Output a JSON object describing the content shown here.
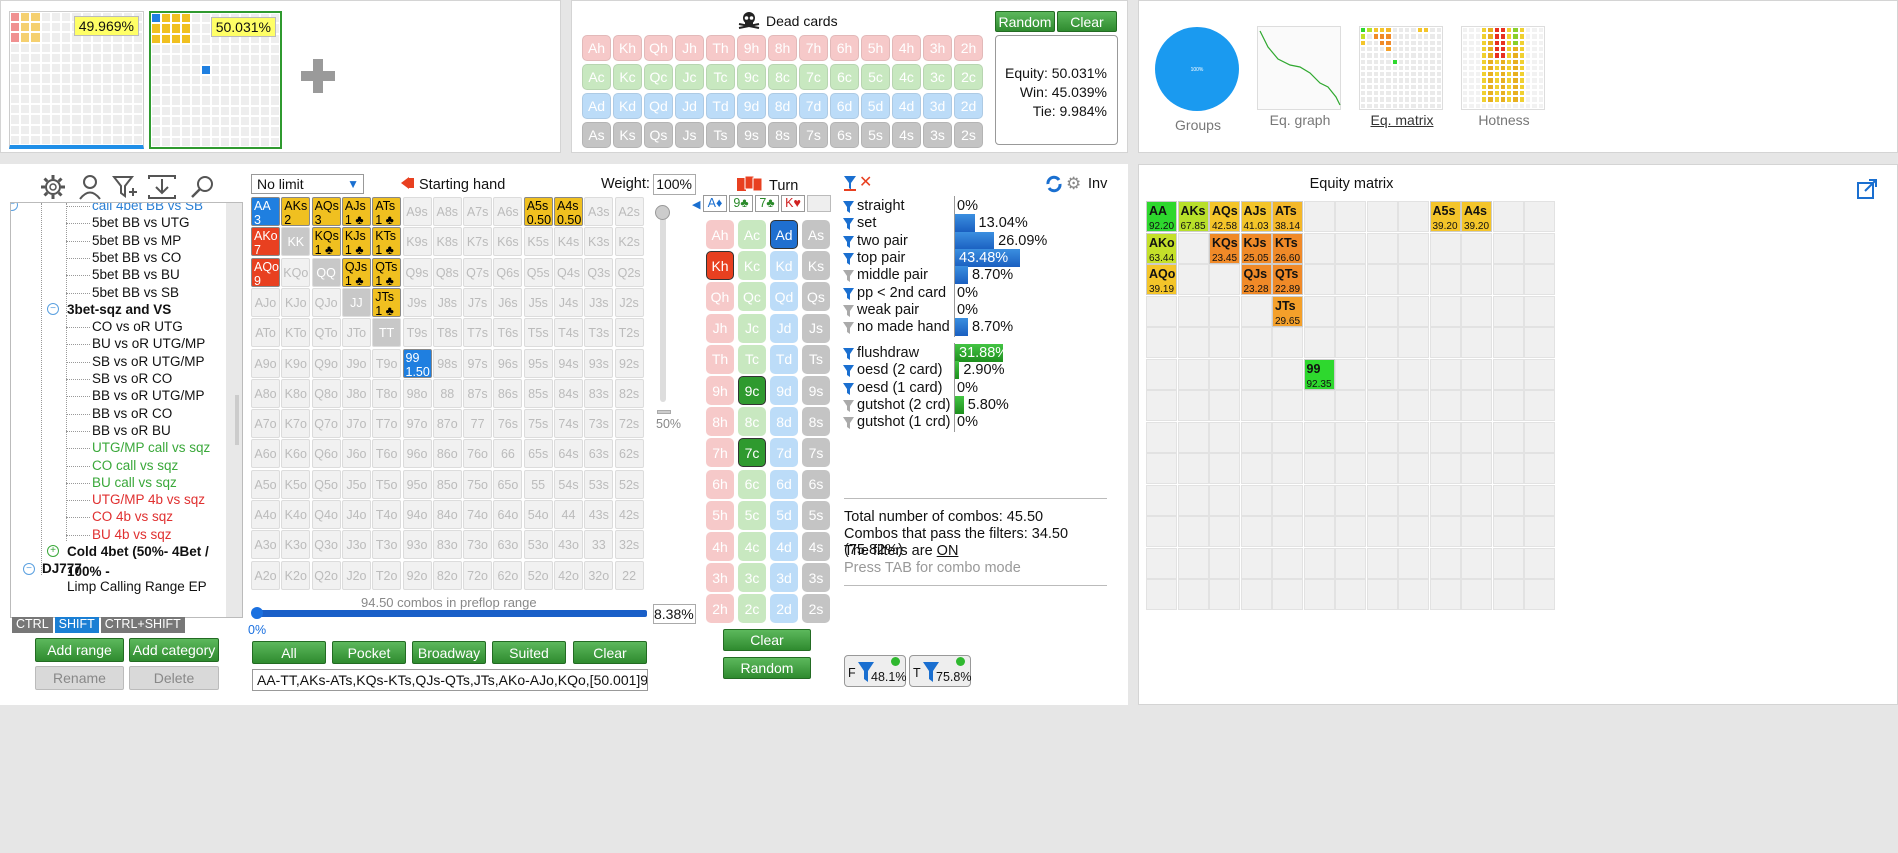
{
  "top_left": {
    "equity_left": "49.969%",
    "equity_right": "50.031%",
    "add_icon": "plus-icon"
  },
  "dead_cards": {
    "title": "Dead cards",
    "icon": "skull-icon",
    "random_label": "Random",
    "clear_label": "Clear",
    "rows": [
      {
        "color": "#f6c9c9",
        "text_color": "#fff",
        "cards": [
          "Ah",
          "Kh",
          "Qh",
          "Jh",
          "Th",
          "9h",
          "8h",
          "7h",
          "6h",
          "5h",
          "4h",
          "3h",
          "2h"
        ]
      },
      {
        "color": "#c8e8c0",
        "text_color": "#fff",
        "cards": [
          "Ac",
          "Kc",
          "Qc",
          "Jc",
          "Tc",
          "9c",
          "8c",
          "7c",
          "6c",
          "5c",
          "4c",
          "3c",
          "2c"
        ]
      },
      {
        "color": "#bcdcf8",
        "text_color": "#fff",
        "cards": [
          "Ad",
          "Kd",
          "Qd",
          "Jd",
          "Td",
          "9d",
          "8d",
          "7d",
          "6d",
          "5d",
          "4d",
          "3d",
          "2d"
        ]
      },
      {
        "color": "#c4c4c4",
        "text_color": "#fff",
        "cards": [
          "As",
          "Ks",
          "Qs",
          "Js",
          "Ts",
          "9s",
          "8s",
          "7s",
          "6s",
          "5s",
          "4s",
          "3s",
          "2s"
        ]
      }
    ],
    "equity": "Equity: 50.031%",
    "win": "Win: 45.039%",
    "tie": "Tie: 9.984%"
  },
  "views": {
    "groups": "Groups",
    "eq_graph": "Eq. graph",
    "eq_matrix": "Eq. matrix",
    "hotness": "Hotness",
    "pie_label": "100%"
  },
  "toolbar_icons": [
    "gear-icon",
    "user-icon",
    "filter-plus-icon",
    "import-icon",
    "search-icon"
  ],
  "tree": {
    "items": [
      {
        "text": "call 4bet BB vs SB",
        "color": "#2a7fd4",
        "indent": 93,
        "bold": false
      },
      {
        "text": "5bet BB vs UTG",
        "color": "#111",
        "indent": 93,
        "bold": false
      },
      {
        "text": "5bet BB vs MP",
        "color": "#111",
        "indent": 93,
        "bold": false
      },
      {
        "text": "5bet BB vs CO",
        "color": "#111",
        "indent": 93,
        "bold": false
      },
      {
        "text": "5bet BB vs BU",
        "color": "#111",
        "indent": 93,
        "bold": false
      },
      {
        "text": "5bet BB vs SB",
        "color": "#111",
        "indent": 93,
        "bold": false
      },
      {
        "text": "3bet-sqz and VS",
        "color": "#111",
        "indent": 68,
        "bold": true
      },
      {
        "text": "CO vs oR UTG",
        "color": "#111",
        "indent": 93,
        "bold": false
      },
      {
        "text": "BU vs oR UTG/MP",
        "color": "#111",
        "indent": 93,
        "bold": false
      },
      {
        "text": "SB vs oR UTG/MP",
        "color": "#111",
        "indent": 93,
        "bold": false
      },
      {
        "text": "SB vs oR CO",
        "color": "#111",
        "indent": 93,
        "bold": false
      },
      {
        "text": "BB vs oR UTG/MP",
        "color": "#111",
        "indent": 93,
        "bold": false
      },
      {
        "text": "BB vs oR CO",
        "color": "#111",
        "indent": 93,
        "bold": false
      },
      {
        "text": "BB vs oR BU",
        "color": "#111",
        "indent": 93,
        "bold": false
      },
      {
        "text": "UTG/MP call vs sqz",
        "color": "#3aa83a",
        "indent": 93,
        "bold": false
      },
      {
        "text": "CO call vs sqz",
        "color": "#3aa83a",
        "indent": 93,
        "bold": false
      },
      {
        "text": "BU call vs sqz",
        "color": "#3aa83a",
        "indent": 93,
        "bold": false
      },
      {
        "text": "UTG/MP 4b vs sqz",
        "color": "#e03030",
        "indent": 93,
        "bold": false
      },
      {
        "text": "CO 4b vs sqz",
        "color": "#e03030",
        "indent": 93,
        "bold": false
      },
      {
        "text": "BU 4b vs sqz",
        "color": "#e03030",
        "indent": 93,
        "bold": false
      },
      {
        "text": "Cold 4bet (50%- 4Bet / 100% -",
        "color": "#111",
        "indent": 68,
        "bold": true
      },
      {
        "text": "DJ777",
        "color": "#111",
        "indent": 43,
        "bold": true
      },
      {
        "text": "Limp Calling Range EP",
        "color": "#111",
        "indent": 68,
        "bold": false
      }
    ],
    "keys": [
      "CTRL",
      "SHIFT",
      "CTRL+SHIFT"
    ],
    "add_range": "Add range",
    "add_category": "Add category",
    "rename": "Rename",
    "delete": "Delete"
  },
  "range": {
    "limit": "No limit",
    "starting_hand": "Starting hand",
    "weight_label": "Weight:",
    "weight_value": "100%",
    "slider_value": "50%",
    "combos_text": "94.50 combos in preflop range",
    "progress_pct": "8.38%",
    "progress_start": "0%",
    "progress_fraction": 0.0838,
    "buttons": [
      "All",
      "Pocket",
      "Broadway",
      "Suited",
      "Clear"
    ],
    "range_text": "AA-TT,AKs-ATs,KQs-KTs,QJs-QTs,JTs,AKo-AJo,KQo,[50.001]99,A5s-A4s",
    "ranks": [
      "A",
      "K",
      "Q",
      "J",
      "T",
      "9",
      "8",
      "7",
      "6",
      "5",
      "4",
      "3",
      "2"
    ],
    "selected": {
      "AA": {
        "line2": "3",
        "color": "#1f7fe0",
        "text": "#fff"
      },
      "AKs": {
        "line2": "2 ♣♠",
        "color": "#f0c020",
        "text": "#000"
      },
      "AQs": {
        "line2": "3",
        "color": "#f0c020",
        "text": "#000"
      },
      "AJs": {
        "line2": "1 ♣",
        "color": "#f0c020",
        "text": "#000"
      },
      "ATs": {
        "line2": "1 ♣",
        "color": "#f0c020",
        "text": "#000"
      },
      "A5s": {
        "line2": "0.50",
        "color": "#f0c020",
        "text": "#000"
      },
      "A4s": {
        "line2": "0.50",
        "color": "#f0c020",
        "text": "#000"
      },
      "AKo": {
        "line2": "7",
        "color": "#e84020",
        "text": "#fff"
      },
      "KQs": {
        "line2": "1 ♣",
        "color": "#f0c020",
        "text": "#000"
      },
      "KJs": {
        "line2": "1 ♣",
        "color": "#f0c020",
        "text": "#000"
      },
      "KTs": {
        "line2": "1 ♣",
        "color": "#f0c020",
        "text": "#000"
      },
      "AQo": {
        "line2": "9",
        "color": "#e84020",
        "text": "#fff"
      },
      "QJs": {
        "line2": "1 ♣",
        "color": "#f0c020",
        "text": "#000"
      },
      "QTs": {
        "line2": "1 ♣",
        "color": "#f0c020",
        "text": "#000"
      },
      "JTs": {
        "line2": "1 ♣",
        "color": "#f0c020",
        "text": "#000"
      },
      "99": {
        "line2": "1.50",
        "color": "#1f7fe0",
        "text": "#fff"
      }
    },
    "dead_gray": [
      "KK",
      "QQ",
      "JJ",
      "TT"
    ]
  },
  "turn": {
    "label": "Turn",
    "board": [
      "A♦",
      "9♣",
      "7♣",
      "K♥"
    ],
    "clear": "Clear",
    "random": "Random",
    "cols": [
      {
        "suit": "h",
        "color": "#f6c9c9",
        "cards": [
          "Ah",
          "Kh",
          "Qh",
          "Jh",
          "Th",
          "9h",
          "8h",
          "7h",
          "6h",
          "5h",
          "4h",
          "3h",
          "2h"
        ]
      },
      {
        "suit": "c",
        "color": "#c8e8c0",
        "cards": [
          "Ac",
          "Kc",
          "Qc",
          "Jc",
          "Tc",
          "9c",
          "8c",
          "7c",
          "6c",
          "5c",
          "4c",
          "3c",
          "2c"
        ]
      },
      {
        "suit": "d",
        "color": "#bcdcf8",
        "cards": [
          "Ad",
          "Kd",
          "Qd",
          "Jd",
          "Td",
          "9d",
          "8d",
          "7d",
          "6d",
          "5d",
          "4d",
          "3d",
          "2d"
        ]
      },
      {
        "suit": "s",
        "color": "#c4c4c4",
        "cards": [
          "As",
          "Ks",
          "Qs",
          "Js",
          "Ts",
          "9s",
          "8s",
          "7s",
          "6s",
          "5s",
          "4s",
          "3s",
          "2s"
        ]
      }
    ],
    "highlight": {
      "Ad": "#1f6fd0",
      "Kh": "#e84020",
      "9c": "#2f9a2f",
      "7c": "#2f9a2f"
    }
  },
  "stats": {
    "inv": "Inv",
    "made": [
      {
        "label": "straight",
        "value": "0%",
        "pct": 0,
        "active": true
      },
      {
        "label": "set",
        "value": "13.04%",
        "pct": 13.04,
        "active": true
      },
      {
        "label": "two pair",
        "value": "26.09%",
        "pct": 26.09,
        "active": true
      },
      {
        "label": "top pair",
        "value": "43.48%",
        "pct": 43.48,
        "active": true
      },
      {
        "label": "middle pair",
        "value": "8.70%",
        "pct": 8.7,
        "active": false
      },
      {
        "label": "pp < 2nd card",
        "value": "0%",
        "pct": 0,
        "active": true
      },
      {
        "label": "weak pair",
        "value": "0%",
        "pct": 0,
        "active": false
      },
      {
        "label": "no made hand",
        "value": "8.70%",
        "pct": 8.7,
        "active": false
      }
    ],
    "draws": [
      {
        "label": "flushdraw",
        "value": "31.88%",
        "pct": 31.88,
        "active": true
      },
      {
        "label": "oesd (2 card)",
        "value": "2.90%",
        "pct": 2.9,
        "active": true
      },
      {
        "label": "oesd (1 card)",
        "value": "0%",
        "pct": 0,
        "active": true
      },
      {
        "label": "gutshot (2 crd)",
        "value": "5.80%",
        "pct": 5.8,
        "active": false
      },
      {
        "label": "gutshot (1 crd)",
        "value": "0%",
        "pct": 0,
        "active": false
      }
    ],
    "total_combos": "Total number of combos: 45.50",
    "combos_pass": "Combos that pass the filters: 34.50 (75.82%)",
    "filters_prefix": "The filters are ",
    "filters_state": "ON",
    "tab_hint": "Press TAB for combo mode",
    "badge_f": "48.1%",
    "badge_t": "75.8%"
  },
  "equity_matrix": {
    "title": "Equity matrix",
    "cells": [
      {
        "r": 0,
        "c": 0,
        "hand": "AA",
        "eq": "92.20",
        "color": "#2ed82e"
      },
      {
        "r": 0,
        "c": 1,
        "hand": "AKs",
        "eq": "67.85",
        "color": "#b8e02a"
      },
      {
        "r": 0,
        "c": 2,
        "hand": "AQs",
        "eq": "42.58",
        "color": "#f4c52a"
      },
      {
        "r": 0,
        "c": 3,
        "hand": "AJs",
        "eq": "41.03",
        "color": "#f4c52a"
      },
      {
        "r": 0,
        "c": 4,
        "hand": "ATs",
        "eq": "38.14",
        "color": "#f4b82a"
      },
      {
        "r": 0,
        "c": 9,
        "hand": "A5s",
        "eq": "39.20",
        "color": "#f4c52a"
      },
      {
        "r": 0,
        "c": 10,
        "hand": "A4s",
        "eq": "39.20",
        "color": "#f4c52a"
      },
      {
        "r": 1,
        "c": 0,
        "hand": "AKo",
        "eq": "63.44",
        "color": "#c4e02a"
      },
      {
        "r": 1,
        "c": 2,
        "hand": "KQs",
        "eq": "23.45",
        "color": "#f08a28"
      },
      {
        "r": 1,
        "c": 3,
        "hand": "KJs",
        "eq": "25.05",
        "color": "#f08a28"
      },
      {
        "r": 1,
        "c": 4,
        "hand": "KTs",
        "eq": "26.60",
        "color": "#f08a28"
      },
      {
        "r": 2,
        "c": 0,
        "hand": "AQo",
        "eq": "39.19",
        "color": "#f4c52a"
      },
      {
        "r": 2,
        "c": 3,
        "hand": "QJs",
        "eq": "23.28",
        "color": "#f08a28"
      },
      {
        "r": 2,
        "c": 4,
        "hand": "QTs",
        "eq": "22.89",
        "color": "#f08a28"
      },
      {
        "r": 3,
        "c": 4,
        "hand": "JTs",
        "eq": "29.65",
        "color": "#f4a02a"
      },
      {
        "r": 5,
        "c": 5,
        "hand": "99",
        "eq": "92.35",
        "color": "#2ed82e"
      }
    ]
  }
}
